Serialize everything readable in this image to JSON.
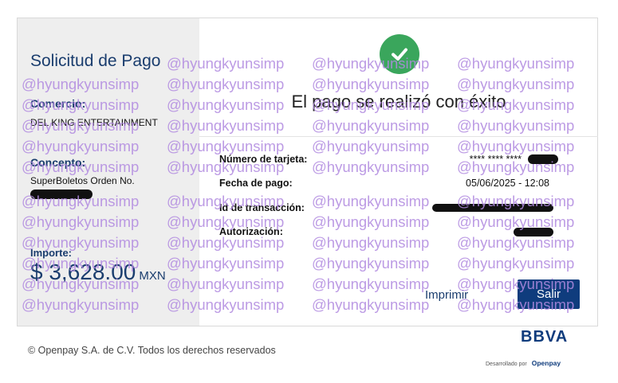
{
  "left_panel": {
    "title": "Solicitud de Pago",
    "merchant_label": "Comercio:",
    "merchant_value": "DEL KING ENTERTAINMENT",
    "concept_label": "Concepto:",
    "concept_value": "SuperBoletos Orden No.",
    "amount_label": "Importe:",
    "amount_value": "$ 3,628.00",
    "amount_currency": "MXN"
  },
  "result": {
    "icon": "check-circle-icon",
    "heading": "El pago se realizó con éxito",
    "rows": [
      {
        "label": "Número de tarjeta:",
        "value": "**** **** ****"
      },
      {
        "label": "Fecha de pago:",
        "value": "05/06/2025 - 12:08"
      },
      {
        "label": "Id de transacción:",
        "value": ""
      },
      {
        "label": "Autorización:",
        "value": ""
      }
    ]
  },
  "actions": {
    "print_label": "Imprimir",
    "exit_label": "Salir"
  },
  "footer": {
    "copyright": "© Openpay S.A. de C.V. Todos los derechos reservados",
    "bank_logo": "BBVA",
    "developed_by": "Desarrollado por",
    "developer_logo": "Openpay"
  },
  "watermark": {
    "text": "@hyungkyunsimp"
  },
  "colors": {
    "brand_navy": "#0f3c7d",
    "title_blue": "#1a3d6e",
    "success_green": "#3aa65c",
    "left_panel_bg": "#eeeeee",
    "watermark": "#b18ae0"
  }
}
